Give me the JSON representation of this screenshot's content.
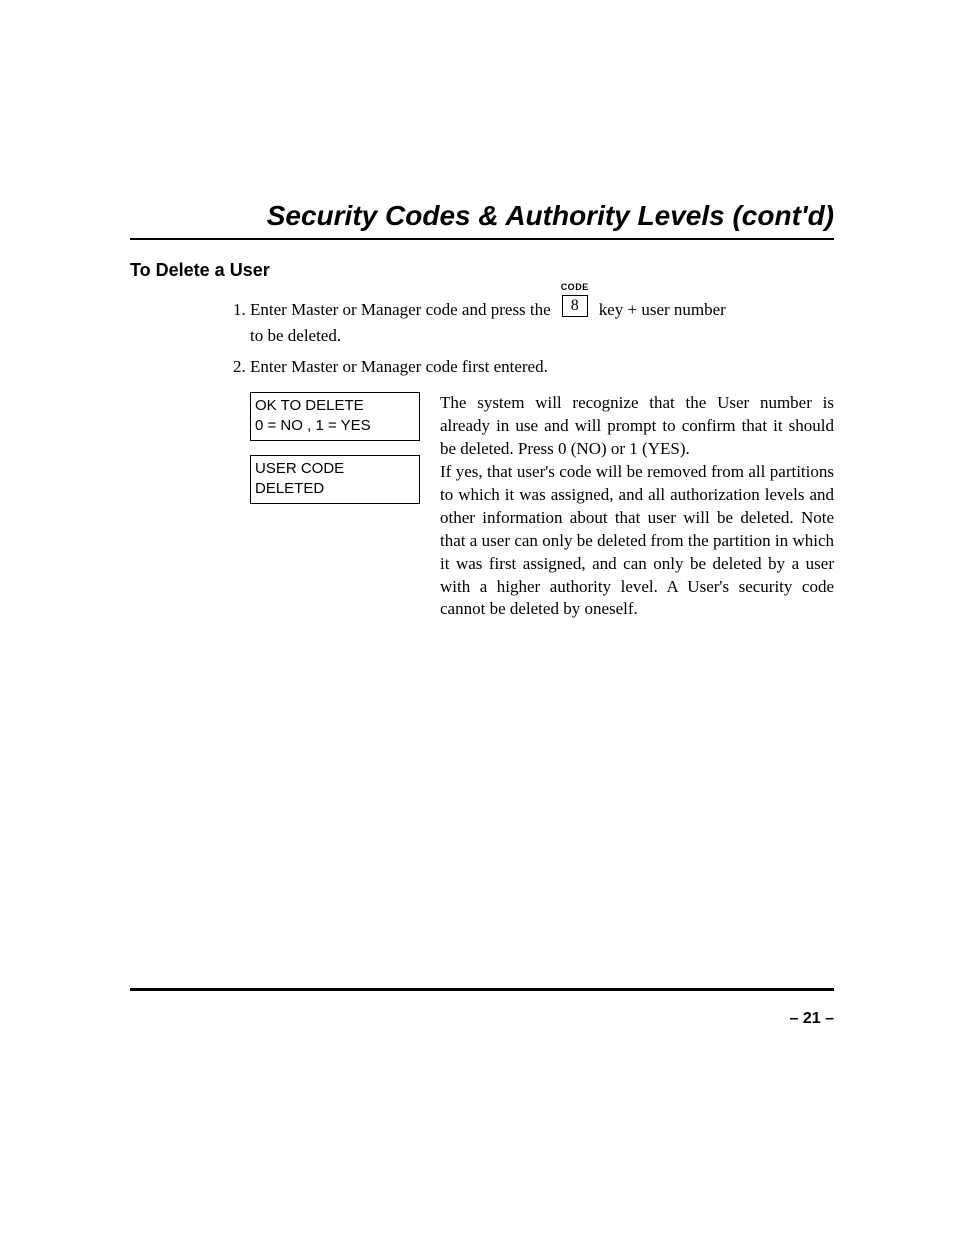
{
  "title": "Security Codes & Authority Levels (cont'd)",
  "subhead": "To Delete a User",
  "key": {
    "label": "CODE",
    "value": "8"
  },
  "steps": {
    "s1a": "Enter Master or Manager code and press the",
    "s1b": "key + user number",
    "s1c": "to be deleted.",
    "s2": "Enter Master or Manager code first entered."
  },
  "displays": {
    "d1_line1": "OK TO DELETE",
    "d1_line2": "0 = NO , 1 = YES",
    "d2_line1": "USER CODE",
    "d2_line2": "DELETED"
  },
  "explain": {
    "p1": "The system will recognize that the User number is already in use and will prompt to confirm that it should be deleted. Press 0 (NO) or 1 (YES).",
    "p2": "If yes, that user's code will be removed from all partitions to which it was assigned, and all authorization levels and other information about that user will be deleted. Note that a user can only be deleted from the partition in which it was first assigned, and can only be deleted by a user with a higher authority level. A User's security code cannot be deleted by oneself."
  },
  "page_number": "– 21 –"
}
